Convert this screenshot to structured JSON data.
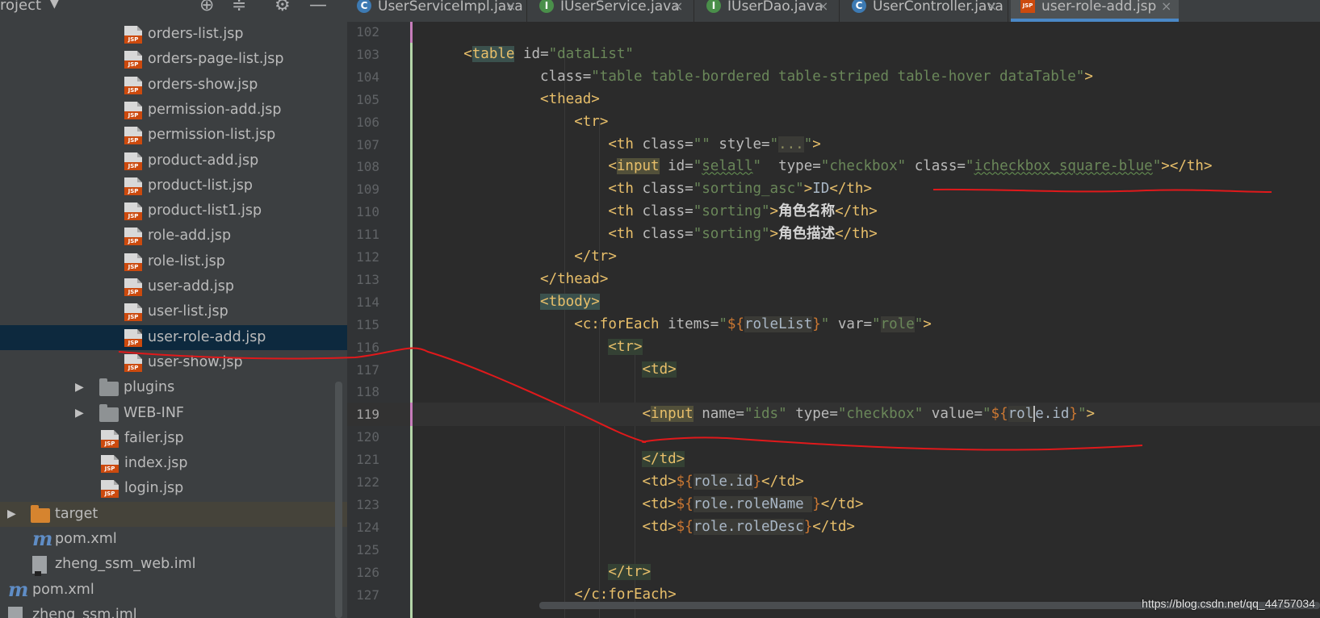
{
  "project_panel": {
    "title": "roject",
    "tree": [
      {
        "label": "orders-list.jsp",
        "type": "jsp"
      },
      {
        "label": "orders-page-list.jsp",
        "type": "jsp"
      },
      {
        "label": "orders-show.jsp",
        "type": "jsp"
      },
      {
        "label": "permission-add.jsp",
        "type": "jsp"
      },
      {
        "label": "permission-list.jsp",
        "type": "jsp"
      },
      {
        "label": "product-add.jsp",
        "type": "jsp"
      },
      {
        "label": "product-list.jsp",
        "type": "jsp"
      },
      {
        "label": "product-list1.jsp",
        "type": "jsp"
      },
      {
        "label": "role-add.jsp",
        "type": "jsp"
      },
      {
        "label": "role-list.jsp",
        "type": "jsp"
      },
      {
        "label": "user-add.jsp",
        "type": "jsp"
      },
      {
        "label": "user-list.jsp",
        "type": "jsp"
      },
      {
        "label": "user-role-add.jsp",
        "type": "jsp",
        "selected": true
      },
      {
        "label": "user-show.jsp",
        "type": "jsp"
      },
      {
        "label": "plugins",
        "type": "folder",
        "collapsed": true
      },
      {
        "label": "WEB-INF",
        "type": "folder",
        "collapsed": true
      },
      {
        "label": "failer.jsp",
        "type": "jsp"
      },
      {
        "label": "index.jsp",
        "type": "jsp"
      },
      {
        "label": "login.jsp",
        "type": "jsp"
      },
      {
        "label": "target",
        "type": "folder-orange",
        "collapsed": true,
        "excluded": true
      },
      {
        "label": "pom.xml",
        "type": "maven"
      },
      {
        "label": "zheng_ssm_web.iml",
        "type": "iml"
      },
      {
        "label": "pom.xml",
        "type": "maven"
      },
      {
        "label": "zheng_ssm.iml",
        "type": "iml"
      }
    ]
  },
  "tabs": [
    {
      "label": "UserServiceImpl.java",
      "icon": "class-icon",
      "icon_char": "C"
    },
    {
      "label": "IUserService.java",
      "icon": "interface-icon",
      "icon_char": "I"
    },
    {
      "label": "IUserDao.java",
      "icon": "interface-icon",
      "icon_char": "I"
    },
    {
      "label": "UserController.java",
      "icon": "class-icon",
      "icon_char": "C"
    },
    {
      "label": "user-role-add.jsp",
      "icon": "jsp-icon",
      "icon_char": "JSP",
      "active": true
    }
  ],
  "tab_close_glyph": "×",
  "editor": {
    "current_line": 119,
    "line_numbers": [
      102,
      103,
      104,
      105,
      106,
      107,
      108,
      109,
      110,
      111,
      112,
      113,
      114,
      115,
      116,
      117,
      118,
      119,
      120,
      121,
      122,
      123,
      124,
      125,
      126,
      127
    ]
  },
  "code": {
    "l103": {
      "tag": "table",
      "attr_id": "id=",
      "val_id": "\"dataList\""
    },
    "l104": {
      "attr": "class=",
      "val": "\"table table-bordered table-striped table-hover dataTable\""
    },
    "l105": {
      "tag": "thead"
    },
    "l106": {
      "tag": "tr"
    },
    "l107": {
      "tag": "th",
      "attr1": "class=",
      "val1": "\"\"",
      "attr2": "style=",
      "q1": "\"",
      "fold": "...",
      "q2": "\""
    },
    "l108": {
      "tag": "input",
      "attr1": "id=",
      "q1": "\"",
      "val1": "selall",
      "q2": "\"",
      "attr2": "type=",
      "val2": "\"checkbox\"",
      "attr3": "class=",
      "q3": "\"",
      "val3": "icheckbox_square-blue",
      "q4": "\"",
      "close": "th"
    },
    "l109": {
      "tag": "th",
      "attr": "class=",
      "val": "\"sorting_asc\"",
      "text": "ID",
      "close": "th"
    },
    "l110": {
      "tag": "th",
      "attr": "class=",
      "val": "\"sorting\"",
      "text": "角色名称",
      "close": "th"
    },
    "l111": {
      "tag": "th",
      "attr": "class=",
      "val": "\"sorting\"",
      "text": "角色描述",
      "close": "th"
    },
    "l112": {
      "close": "tr"
    },
    "l113": {
      "close": "thead"
    },
    "l114": {
      "tag": "tbody"
    },
    "l115": {
      "tag": "c:forEach",
      "attr1": "items=",
      "q1": "\"",
      "el_open": "${",
      "el_var": "roleList",
      "el_close": "}",
      "q2": "\"",
      "attr2": "var=",
      "q3": "\"",
      "val2": "role",
      "q4": "\""
    },
    "l116": {
      "tag": "tr"
    },
    "l117": {
      "tag": "td"
    },
    "l119": {
      "tag": "input",
      "attr1": "name=",
      "val1": "\"ids\"",
      "attr2": "type=",
      "val2": "\"checkbox\"",
      "attr3": "value=",
      "q1": "\"",
      "el_open": "${",
      "el_a": "rol",
      "el_b": "e.id",
      "el_close": "}",
      "q2": "\""
    },
    "l121": {
      "close": "td"
    },
    "l122": {
      "tag": "td",
      "el_open": "${",
      "el_var": "role.id",
      "el_close": "}",
      "close": "td"
    },
    "l123": {
      "tag": "td",
      "el_open": "${",
      "el_var": "role.roleName ",
      "el_close": "}",
      "close": "td"
    },
    "l124": {
      "tag": "td",
      "el_open": "${",
      "el_var": "role.roleDesc",
      "el_close": "}",
      "close": "td"
    },
    "l126": {
      "close": "tr"
    },
    "l127": {
      "close": "c:forEach"
    }
  },
  "watermark": "https://blog.csdn.net/qq_44757034",
  "colors": {
    "annotation": "#e0191b",
    "selection": "#0d293e",
    "accent": "#4a88c7"
  }
}
